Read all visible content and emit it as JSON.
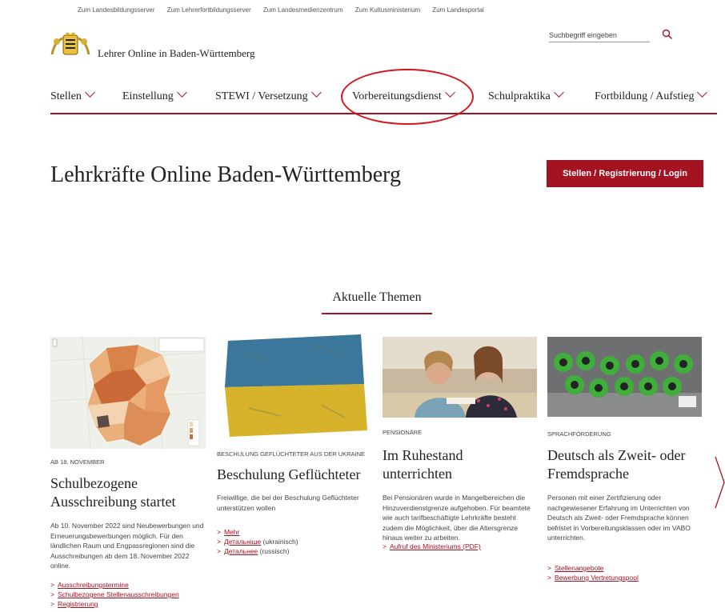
{
  "topbar": {
    "links": [
      "Zum Landesbildungsserver",
      "Zum Lehrerfortbildungsserver",
      "Zum Landesmedienzentrum",
      "Zum Kultusministerium",
      "Zum Landesportal"
    ]
  },
  "header": {
    "site_title": "Lehrer Online in Baden-Württemberg",
    "search_placeholder": "Suchbegriff eingeben"
  },
  "nav": {
    "items": [
      "Stellen",
      "Einstellung",
      "STEWI / Versetzung",
      "Vorbereitungsdienst",
      "Schulpraktika",
      "Fortbildung / Aufstieg"
    ]
  },
  "hero": {
    "title": "Lehrkräfte Online Baden-Württemberg",
    "button": "Stellen / Registrierung / Login"
  },
  "section": {
    "title": "Aktuelle Themen"
  },
  "cards": [
    {
      "kicker": "AB 18. NOVEMBER",
      "title": "Schulbezogene Ausschreibung startet",
      "text": "Ab 10. November 2022 sind Neubewerbungen und Erneuerungsbewerbungen möglich. Für den ländlichen Raum und Engpassregionen sind die Ausschreibungen ab dem 18. November 2022 online.",
      "links": [
        "Ausschreibungstermine",
        "Schulbezogene Stellenausschreibungen",
        "Registrierung"
      ]
    },
    {
      "kicker": "BESCHULUNG GEFLÜCHTETER AUS DER UKRAINE",
      "title": "Beschulung Geflüchteter",
      "text": "Freiwillige, die bei der Beschulung Geflüchteter unterstützen wollen",
      "links": [
        "Mehr",
        "Детальніше",
        "Детальнее"
      ],
      "link_notes": [
        "",
        "(ukrainisch)",
        "(russisch)"
      ]
    },
    {
      "kicker": "PENSIONÄRE",
      "title": "Im Ruhestand unterrichten",
      "text": "Bei Pensionären wurde in Mangelbereichen die Hinzuverdienstgrenze aufgehoben. Für beamtete wie auch tarifbeschäftigte Lehrkräfte besteht zudem die Möglichkeit, über die Altersgrenze hinaus weiter zu arbeiten.",
      "links": [
        "Aufruf des Ministeriums (PDF)"
      ]
    },
    {
      "kicker": "SPRACHFÖRDERUNG",
      "title": "Deutsch als Zweit- oder Fremdsprache",
      "text": "Personen mit einer Zertifizierung oder nachgewiesener Erfahrung im Unterrichten von Deutsch als Zweit- oder Fremdsprache können befristet in Vorbereitungsklassen oder im VABO unterrichten.",
      "links": [
        "Stellenangebote",
        "Bewerbung Vertretungspool"
      ]
    }
  ],
  "colors": {
    "accent": "#a31322",
    "highlight": "#d6141e"
  },
  "icons": {
    "search": "search-icon",
    "nav_chevron": "chevron-down-icon",
    "link_arrow": "chevron-right-icon",
    "carousel": "carousel-next-icon"
  }
}
